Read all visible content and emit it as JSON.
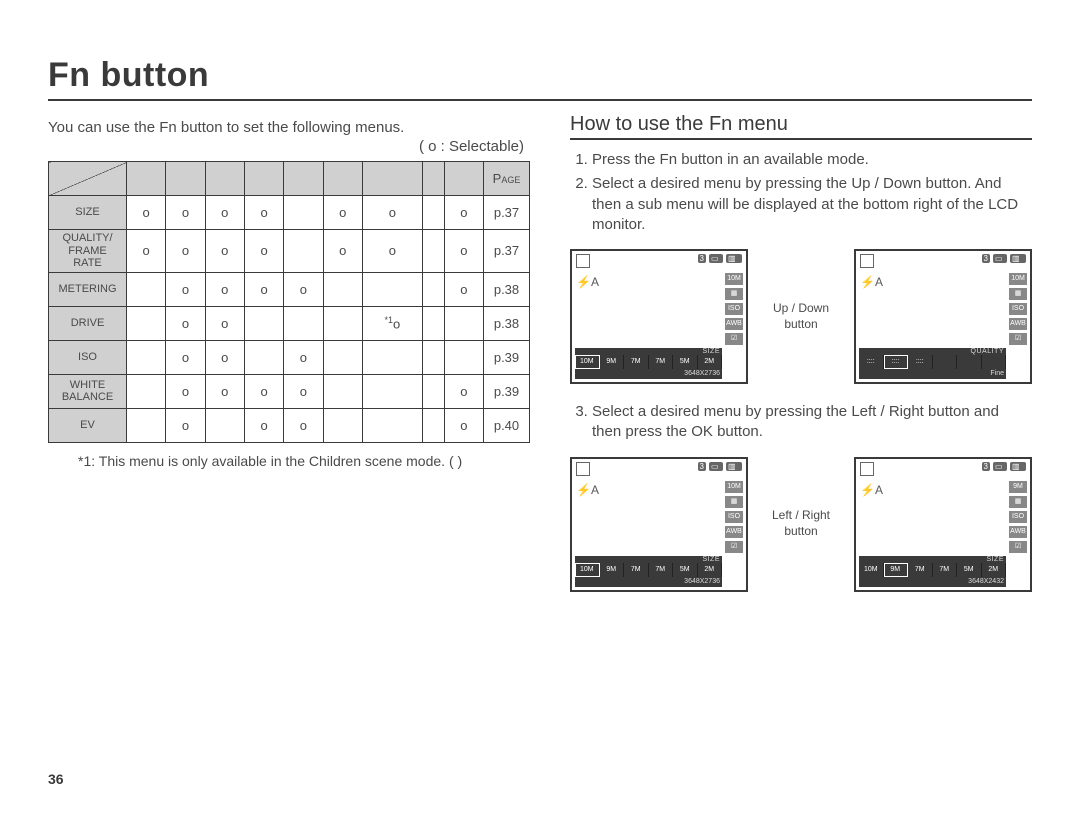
{
  "title": "Fn button",
  "intro": "You can use the Fn button to set the following menus.",
  "legend": "( o : Selectable)",
  "page_number": "36",
  "table": {
    "page_header": "Page",
    "rows": [
      {
        "label": "SIZE",
        "cells": [
          "o",
          "o",
          "o",
          "o",
          "",
          "o",
          "o",
          "",
          "o"
        ],
        "page": "p.37"
      },
      {
        "label": "QUALITY/\nFRAME RATE",
        "cells": [
          "o",
          "o",
          "o",
          "o",
          "",
          "o",
          "o",
          "",
          "o"
        ],
        "page": "p.37"
      },
      {
        "label": "METERING",
        "cells": [
          "",
          "o",
          "o",
          "o",
          "o",
          "",
          "",
          "",
          "o"
        ],
        "page": "p.38"
      },
      {
        "label": "DRIVE",
        "cells": [
          "",
          "o",
          "o",
          "",
          "",
          "",
          "*1o",
          "",
          ""
        ],
        "page": "p.38"
      },
      {
        "label": "ISO",
        "cells": [
          "",
          "o",
          "o",
          "",
          "o",
          "",
          "",
          "",
          ""
        ],
        "page": "p.39"
      },
      {
        "label": "WHITE\nBALANCE",
        "cells": [
          "",
          "o",
          "o",
          "o",
          "o",
          "",
          "",
          "",
          "o"
        ],
        "page": "p.39"
      },
      {
        "label": "EV",
        "cells": [
          "",
          "o",
          "",
          "o",
          "o",
          "",
          "",
          "",
          "o"
        ],
        "page": "p.40"
      }
    ]
  },
  "footnote": "*1: This menu is only available in the Children scene mode. (        )",
  "right": {
    "heading": "How to use the Fn menu",
    "step1": "Press the Fn button in an available mode.",
    "step2": "Select a desired menu by pressing the Up / Down button. And then a sub menu will be displayed at the bottom right of the LCD monitor.",
    "step3": "Select a desired menu by pressing the Left / Right button and then press the OK button.",
    "label_updown": "Up / Down button",
    "label_leftright": "Left / Right button"
  },
  "lcd": {
    "top_count": "3",
    "badge_10": "10M",
    "badge_9": "9M",
    "iso": "ISO",
    "awb": "AWB",
    "size_label": "SIZE",
    "quality_label": "QUALITY",
    "opts_size": [
      "10M",
      "9M",
      "7M",
      "7M",
      "5M",
      "2M"
    ],
    "opts_size2": [
      "10M",
      "9M",
      "7M",
      "7M",
      "5M",
      "2M"
    ],
    "res1": "3648X2736",
    "res2": "3648X2432",
    "quality_fine": "Fine",
    "quality_dots": "::::"
  }
}
